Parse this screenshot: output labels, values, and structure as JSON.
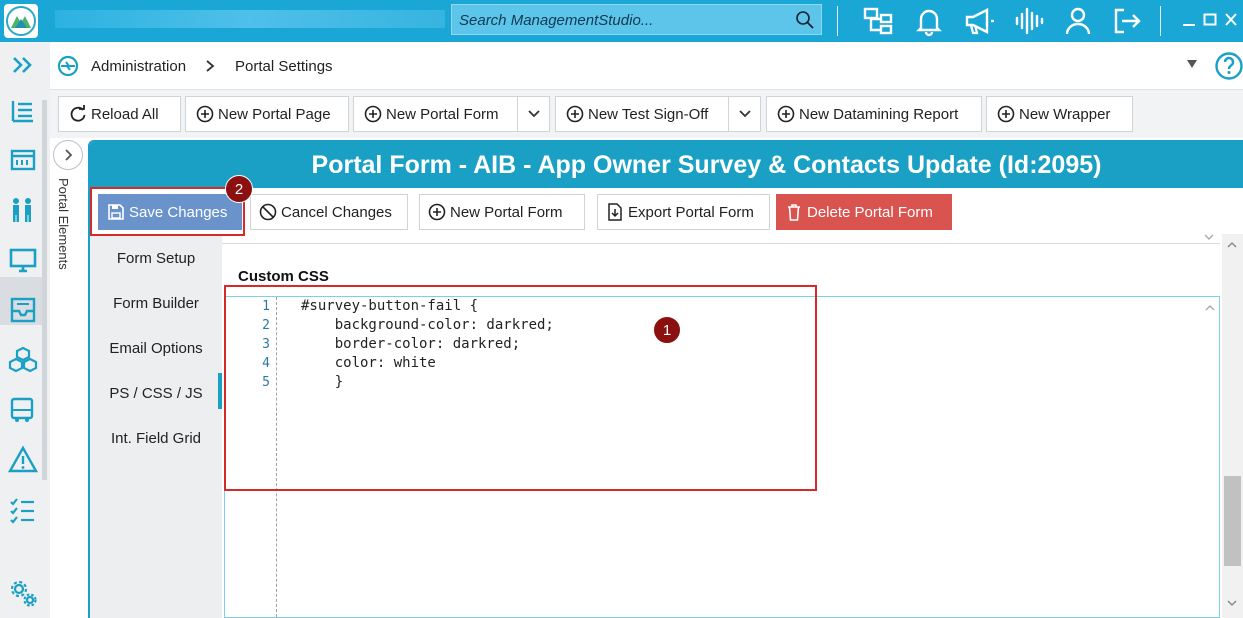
{
  "search": {
    "placeholder": "Search ManagementStudio..."
  },
  "breadcrumb": {
    "items": [
      "Administration",
      "Portal Settings"
    ]
  },
  "toolbar": {
    "reload_all": "Reload All",
    "new_portal_page": "New Portal Page",
    "new_portal_form": "New Portal Form",
    "new_test_signoff": "New Test Sign-Off",
    "new_datamining_report": "New Datamining Report",
    "new_wrapper": "New Wrapper"
  },
  "portal_elements": {
    "label": "Portal Elements"
  },
  "form": {
    "title": "Portal Form -  AIB - App Owner Survey & Contacts Update  (Id:2095)",
    "actions": {
      "save": "Save Changes",
      "cancel": "Cancel Changes",
      "new": "New Portal Form",
      "export": "Export Portal Form",
      "delete": "Delete Portal Form"
    },
    "nav": [
      "Form Setup",
      "Form Builder",
      "Email Options",
      "PS / CSS / JS",
      "Int. Field Grid"
    ],
    "active_nav": "PS / CSS / JS",
    "section_label": "Custom CSS",
    "code_lines": [
      {
        "num": "1",
        "text": "#survey-button-fail {"
      },
      {
        "num": "2",
        "text": "    background-color: darkred;"
      },
      {
        "num": "3",
        "text": "    border-color: darkred;"
      },
      {
        "num": "4",
        "text": "    color: white"
      },
      {
        "num": "5",
        "text": "    }"
      }
    ]
  },
  "annotations": {
    "badge_1": "1",
    "badge_2": "2"
  },
  "colors": {
    "accent": "#1aa0c4",
    "topbar": "#1aa7d6",
    "highlight": "#d62a2a",
    "badge": "#8b1010",
    "save": "#6a93cc",
    "delete": "#d9534f"
  }
}
